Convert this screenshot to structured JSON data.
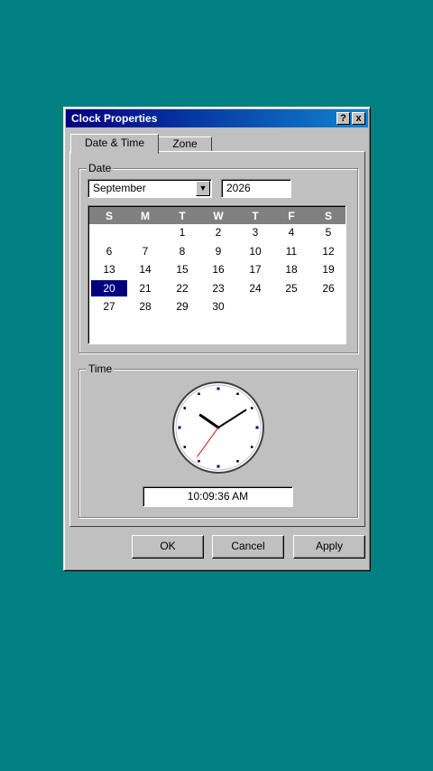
{
  "window": {
    "title": "Clock Properties",
    "help_label": "?",
    "close_label": "x"
  },
  "tabs": [
    {
      "label": "Date & Time"
    },
    {
      "label": "Zone"
    }
  ],
  "date_group": {
    "label": "Date",
    "month": "September",
    "year": "2026",
    "weekdays": [
      "S",
      "M",
      "T",
      "W",
      "T",
      "F",
      "S"
    ],
    "weeks": [
      [
        "",
        "",
        "1",
        "2",
        "3",
        "4",
        "5"
      ],
      [
        "6",
        "7",
        "8",
        "9",
        "10",
        "11",
        "12"
      ],
      [
        "13",
        "14",
        "15",
        "16",
        "17",
        "18",
        "19"
      ],
      [
        "20",
        "21",
        "22",
        "23",
        "24",
        "25",
        "26"
      ],
      [
        "27",
        "28",
        "29",
        "30",
        "",
        "",
        ""
      ]
    ],
    "selected_day": "20"
  },
  "time_group": {
    "label": "Time",
    "time_text": "10:09:36 AM",
    "clock": {
      "hour": 10,
      "minute": 9,
      "second": 36
    }
  },
  "buttons": {
    "ok": "OK",
    "cancel": "Cancel",
    "apply": "Apply"
  },
  "colors": {
    "desktop": "#008080",
    "title_active": "#000080",
    "selection": "#000080",
    "second_hand": "#e00000"
  }
}
